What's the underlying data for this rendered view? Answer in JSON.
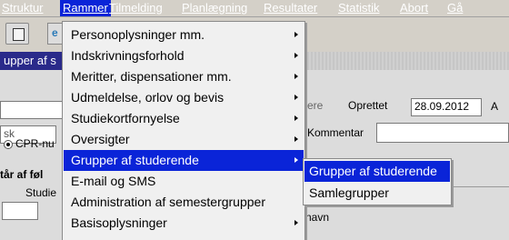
{
  "menubar": {
    "items": [
      "Struktur",
      "Rammer",
      "Tilmelding",
      "Planlægning",
      "Resultater",
      "Statistik",
      "Abort",
      "Gå"
    ]
  },
  "window": {
    "title": "upper af s"
  },
  "form": {
    "search_value": "sk",
    "radio_label": "CPR-nu",
    "section_label": "tår af føl",
    "studie_label": "Studie",
    "created_label_partial": "ere",
    "created_label": "Oprettet",
    "created_date": "28.09.2012",
    "trailing_letter": "A",
    "comment_label": "Kommentar",
    "name_col_label": "navn"
  },
  "dropdown": {
    "items": [
      {
        "label": "Personoplysninger mm.",
        "submenu": true
      },
      {
        "label": "Indskrivningsforhold",
        "submenu": true
      },
      {
        "label": "Meritter, dispensationer mm.",
        "submenu": true
      },
      {
        "label": "Udmeldelse, orlov og bevis",
        "submenu": true
      },
      {
        "label": "Studiekortfornyelse",
        "submenu": true
      },
      {
        "label": "Oversigter",
        "submenu": true
      },
      {
        "label": "Grupper af studerende",
        "submenu": true
      },
      {
        "label": "E-mail og SMS",
        "submenu": false
      },
      {
        "label": "Administration af semestergrupper",
        "submenu": false
      },
      {
        "label": "Basisoplysninger",
        "submenu": true
      }
    ]
  },
  "submenu": {
    "items": [
      "Grupper af studerende",
      "Samlegrupper"
    ]
  },
  "colors": {
    "highlight": "#0a24d8",
    "menu_bg": "#f0f0f0"
  }
}
